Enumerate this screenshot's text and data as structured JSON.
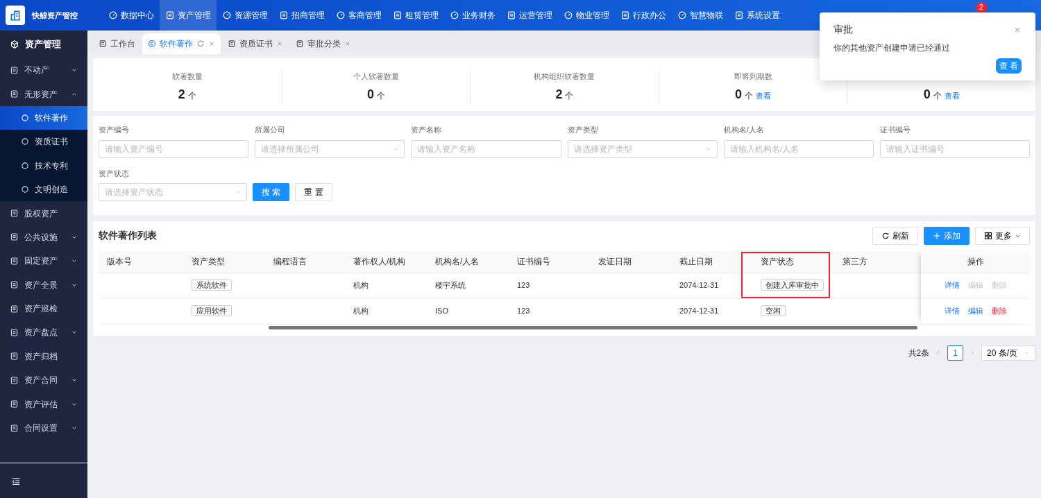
{
  "brand": {
    "name": "快鲸资产管控"
  },
  "top_nav": [
    {
      "label": "数据中心",
      "selected": false
    },
    {
      "label": "资产管理",
      "selected": true
    },
    {
      "label": "资源管理",
      "selected": false
    },
    {
      "label": "招商管理",
      "selected": false
    },
    {
      "label": "客商管理",
      "selected": false
    },
    {
      "label": "租赁管理",
      "selected": false
    },
    {
      "label": "业务财务",
      "selected": false
    },
    {
      "label": "运营管理",
      "selected": false
    },
    {
      "label": "物业管理",
      "selected": false
    },
    {
      "label": "行政办公",
      "selected": false
    },
    {
      "label": "智慧物联",
      "selected": false
    },
    {
      "label": "系统设置",
      "selected": false
    }
  ],
  "notifications": {
    "badge": "2"
  },
  "sidebar": {
    "title": "资产管理",
    "items": [
      {
        "label": "不动产",
        "kind": "group",
        "expanded": false
      },
      {
        "label": "无形资产",
        "kind": "group",
        "expanded": true,
        "children": [
          {
            "label": "软件著作",
            "selected": true
          },
          {
            "label": "资质证书",
            "selected": false
          },
          {
            "label": "技术专利",
            "selected": false
          },
          {
            "label": "文明创造",
            "selected": false
          }
        ]
      },
      {
        "label": "股权资产",
        "kind": "link"
      },
      {
        "label": "公共设施",
        "kind": "group",
        "expanded": false
      },
      {
        "label": "固定资产",
        "kind": "group",
        "expanded": false
      },
      {
        "label": "资产全景",
        "kind": "group",
        "expanded": false
      },
      {
        "label": "资产巡检",
        "kind": "link"
      },
      {
        "label": "资产盘点",
        "kind": "group",
        "expanded": false
      },
      {
        "label": "资产归档",
        "kind": "link"
      },
      {
        "label": "资产合同",
        "kind": "group",
        "expanded": false
      },
      {
        "label": "资产评估",
        "kind": "group",
        "expanded": false
      },
      {
        "label": "合同设置",
        "kind": "group",
        "expanded": false
      }
    ]
  },
  "tabs": [
    {
      "label": "工作台",
      "selected": false,
      "closable": false
    },
    {
      "label": "软件著作",
      "selected": true,
      "closable": true
    },
    {
      "label": "资质证书",
      "selected": false,
      "closable": true
    },
    {
      "label": "审批分类",
      "selected": false,
      "closable": true
    }
  ],
  "stats": [
    {
      "label": "软著数量",
      "value": "2",
      "unit": "个"
    },
    {
      "label": "个人软著数量",
      "value": "0",
      "unit": "个"
    },
    {
      "label": "机构组织软著数量",
      "value": "2",
      "unit": "个"
    },
    {
      "label": "即将到期数",
      "value": "0",
      "unit": "个",
      "link": "查看"
    },
    {
      "value": "0",
      "unit": "个",
      "link": "查看"
    }
  ],
  "filters": [
    {
      "label": "资产编号",
      "kind": "input",
      "placeholder": "请输入资产编号"
    },
    {
      "label": "所属公司",
      "kind": "select",
      "placeholder": "请选择所属公司"
    },
    {
      "label": "资产名称",
      "kind": "input",
      "placeholder": "请输入资产名称"
    },
    {
      "label": "资产类型",
      "kind": "select",
      "placeholder": "请选择资产类型"
    },
    {
      "label": "机构名/人名",
      "kind": "input",
      "placeholder": "请输入机构名/人名"
    },
    {
      "label": "证书编号",
      "kind": "input",
      "placeholder": "请输入证书编号"
    },
    {
      "label": "资产状态",
      "kind": "select",
      "placeholder": "请选择资产状态"
    }
  ],
  "filter_buttons": {
    "search": "搜 索",
    "reset": "重 置"
  },
  "table": {
    "title": "软件著作列表",
    "toolbar": {
      "refresh": "刷新",
      "add": "添加",
      "more": "更多"
    },
    "columns": [
      {
        "label": "版本号",
        "highlighted": false
      },
      {
        "label": "资产类型",
        "highlighted": false
      },
      {
        "label": "编程语言",
        "highlighted": false
      },
      {
        "label": "著作权人/机构",
        "highlighted": false
      },
      {
        "label": "机构名/人名",
        "highlighted": false
      },
      {
        "label": "证书编号",
        "highlighted": false
      },
      {
        "label": "发证日期",
        "highlighted": false
      },
      {
        "label": "截止日期",
        "highlighted": false
      },
      {
        "label": "资产状态",
        "highlighted": true
      },
      {
        "label": "第三方",
        "highlighted": false
      }
    ],
    "actions_column": "操作",
    "rows": [
      {
        "highlighted": true,
        "cells": [
          "",
          {
            "tag": "系统软件"
          },
          "",
          "机构",
          "楼宇系统",
          "123",
          "",
          "2074-12-31",
          {
            "tag": "创建入库审批中"
          },
          ""
        ],
        "actions": [
          {
            "label": "详情",
            "kind": "view",
            "disabled": false
          },
          {
            "label": "编辑",
            "kind": "edit",
            "disabled": true
          },
          {
            "label": "删除",
            "kind": "delete",
            "disabled": true
          }
        ]
      },
      {
        "highlighted": false,
        "cells": [
          "",
          {
            "tag": "应用软件"
          },
          "",
          "机构",
          "ISO",
          "123",
          "",
          "2074-12-31",
          {
            "tag": "空闲"
          },
          ""
        ],
        "actions": [
          {
            "label": "详情",
            "kind": "view",
            "disabled": false
          },
          {
            "label": "编辑",
            "kind": "edit",
            "disabled": false
          },
          {
            "label": "删除",
            "kind": "delete",
            "disabled": false
          }
        ]
      }
    ]
  },
  "pagination": {
    "total": "共2条",
    "pages": [
      {
        "label": "1",
        "selected": true
      }
    ],
    "page_size": "20 条/页"
  },
  "popup": {
    "title": "审批",
    "message": "你的其他资产创建申请已经通过",
    "button": "查 看"
  }
}
